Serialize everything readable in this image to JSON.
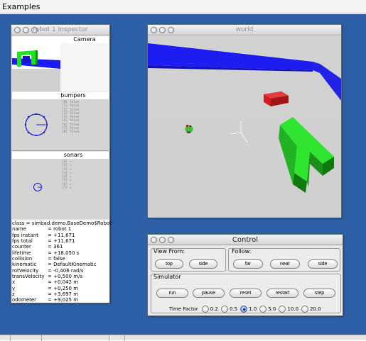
{
  "menubar": {
    "label": "Examples"
  },
  "inspector": {
    "title": "robot 1 Inspector",
    "camera_label": "Camera",
    "bumpers_label": "bumpers",
    "sonars_label": "sonars",
    "bumper_values": [
      "[0] false",
      "[1] false",
      "[2] false",
      "[3] false",
      "[4] false",
      "[5] false",
      "[6] false",
      "[7] false",
      "[8] false"
    ],
    "sonar_values": [
      "[0] =",
      "[1] =",
      "[2] =",
      "[3] =",
      "[4] =",
      "[5] =",
      "[6] =",
      "[7] ="
    ],
    "properties": [
      {
        "key": "class",
        "value": "= simbad.demo.BaseDemo$Robot"
      },
      {
        "key": "name",
        "value": "= robot 1"
      },
      {
        "key": "fps instant",
        "value": "= +11,671"
      },
      {
        "key": "fps total",
        "value": "= +11,671"
      },
      {
        "key": "counter",
        "value": "= 361"
      },
      {
        "key": "lifetime",
        "value": "= +18,050 s"
      },
      {
        "key": "collision",
        "value": "= false"
      },
      {
        "key": "kinematic",
        "value": "= DefaultKinematic"
      },
      {
        "key": "rotVelocity",
        "value": "= -0,406 rad/s"
      },
      {
        "key": "transVelocity",
        "value": "= +0,500 m/s"
      },
      {
        "key": "x",
        "value": "= +0,042 m"
      },
      {
        "key": "y",
        "value": "= +0,250 m"
      },
      {
        "key": "z",
        "value": "= +3,697 m"
      },
      {
        "key": "odometer",
        "value": "= +9,025 m"
      }
    ]
  },
  "world": {
    "title": "world"
  },
  "control": {
    "title": "Control",
    "view_from_label": "View From:",
    "follow_label": "Follow:",
    "simulator_label": "Simulator",
    "view_buttons": [
      "top",
      "side"
    ],
    "follow_buttons": [
      "far",
      "near",
      "side"
    ],
    "sim_buttons": [
      "run",
      "pause",
      "reset",
      "restart",
      "step"
    ],
    "time_factor_label": "Time Factor",
    "time_factors": [
      "0.2",
      "0.5",
      "1.0",
      "5.0",
      "10.0",
      "20.0"
    ],
    "time_factor_selected": "1.0"
  },
  "colors": {
    "desktop": "#2d5fa6",
    "wall": "#1c1cf0",
    "box": "#2fe52f",
    "red_box": "#d01f1f",
    "floor": "#d6d6d6"
  }
}
